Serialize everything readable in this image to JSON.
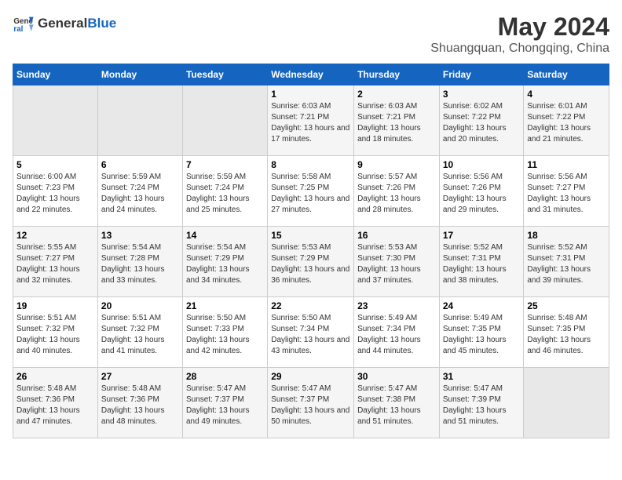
{
  "header": {
    "logo_general": "General",
    "logo_blue": "Blue",
    "title": "May 2024",
    "subtitle": "Shuangquan, Chongqing, China"
  },
  "days_of_week": [
    "Sunday",
    "Monday",
    "Tuesday",
    "Wednesday",
    "Thursday",
    "Friday",
    "Saturday"
  ],
  "weeks": [
    [
      {
        "day": "",
        "sunrise": "",
        "sunset": "",
        "daylight": "",
        "empty": true
      },
      {
        "day": "",
        "sunrise": "",
        "sunset": "",
        "daylight": "",
        "empty": true
      },
      {
        "day": "",
        "sunrise": "",
        "sunset": "",
        "daylight": "",
        "empty": true
      },
      {
        "day": "1",
        "sunrise": "Sunrise: 6:03 AM",
        "sunset": "Sunset: 7:21 PM",
        "daylight": "Daylight: 13 hours and 17 minutes.",
        "empty": false
      },
      {
        "day": "2",
        "sunrise": "Sunrise: 6:03 AM",
        "sunset": "Sunset: 7:21 PM",
        "daylight": "Daylight: 13 hours and 18 minutes.",
        "empty": false
      },
      {
        "day": "3",
        "sunrise": "Sunrise: 6:02 AM",
        "sunset": "Sunset: 7:22 PM",
        "daylight": "Daylight: 13 hours and 20 minutes.",
        "empty": false
      },
      {
        "day": "4",
        "sunrise": "Sunrise: 6:01 AM",
        "sunset": "Sunset: 7:22 PM",
        "daylight": "Daylight: 13 hours and 21 minutes.",
        "empty": false
      }
    ],
    [
      {
        "day": "5",
        "sunrise": "Sunrise: 6:00 AM",
        "sunset": "Sunset: 7:23 PM",
        "daylight": "Daylight: 13 hours and 22 minutes.",
        "empty": false
      },
      {
        "day": "6",
        "sunrise": "Sunrise: 5:59 AM",
        "sunset": "Sunset: 7:24 PM",
        "daylight": "Daylight: 13 hours and 24 minutes.",
        "empty": false
      },
      {
        "day": "7",
        "sunrise": "Sunrise: 5:59 AM",
        "sunset": "Sunset: 7:24 PM",
        "daylight": "Daylight: 13 hours and 25 minutes.",
        "empty": false
      },
      {
        "day": "8",
        "sunrise": "Sunrise: 5:58 AM",
        "sunset": "Sunset: 7:25 PM",
        "daylight": "Daylight: 13 hours and 27 minutes.",
        "empty": false
      },
      {
        "day": "9",
        "sunrise": "Sunrise: 5:57 AM",
        "sunset": "Sunset: 7:26 PM",
        "daylight": "Daylight: 13 hours and 28 minutes.",
        "empty": false
      },
      {
        "day": "10",
        "sunrise": "Sunrise: 5:56 AM",
        "sunset": "Sunset: 7:26 PM",
        "daylight": "Daylight: 13 hours and 29 minutes.",
        "empty": false
      },
      {
        "day": "11",
        "sunrise": "Sunrise: 5:56 AM",
        "sunset": "Sunset: 7:27 PM",
        "daylight": "Daylight: 13 hours and 31 minutes.",
        "empty": false
      }
    ],
    [
      {
        "day": "12",
        "sunrise": "Sunrise: 5:55 AM",
        "sunset": "Sunset: 7:27 PM",
        "daylight": "Daylight: 13 hours and 32 minutes.",
        "empty": false
      },
      {
        "day": "13",
        "sunrise": "Sunrise: 5:54 AM",
        "sunset": "Sunset: 7:28 PM",
        "daylight": "Daylight: 13 hours and 33 minutes.",
        "empty": false
      },
      {
        "day": "14",
        "sunrise": "Sunrise: 5:54 AM",
        "sunset": "Sunset: 7:29 PM",
        "daylight": "Daylight: 13 hours and 34 minutes.",
        "empty": false
      },
      {
        "day": "15",
        "sunrise": "Sunrise: 5:53 AM",
        "sunset": "Sunset: 7:29 PM",
        "daylight": "Daylight: 13 hours and 36 minutes.",
        "empty": false
      },
      {
        "day": "16",
        "sunrise": "Sunrise: 5:53 AM",
        "sunset": "Sunset: 7:30 PM",
        "daylight": "Daylight: 13 hours and 37 minutes.",
        "empty": false
      },
      {
        "day": "17",
        "sunrise": "Sunrise: 5:52 AM",
        "sunset": "Sunset: 7:31 PM",
        "daylight": "Daylight: 13 hours and 38 minutes.",
        "empty": false
      },
      {
        "day": "18",
        "sunrise": "Sunrise: 5:52 AM",
        "sunset": "Sunset: 7:31 PM",
        "daylight": "Daylight: 13 hours and 39 minutes.",
        "empty": false
      }
    ],
    [
      {
        "day": "19",
        "sunrise": "Sunrise: 5:51 AM",
        "sunset": "Sunset: 7:32 PM",
        "daylight": "Daylight: 13 hours and 40 minutes.",
        "empty": false
      },
      {
        "day": "20",
        "sunrise": "Sunrise: 5:51 AM",
        "sunset": "Sunset: 7:32 PM",
        "daylight": "Daylight: 13 hours and 41 minutes.",
        "empty": false
      },
      {
        "day": "21",
        "sunrise": "Sunrise: 5:50 AM",
        "sunset": "Sunset: 7:33 PM",
        "daylight": "Daylight: 13 hours and 42 minutes.",
        "empty": false
      },
      {
        "day": "22",
        "sunrise": "Sunrise: 5:50 AM",
        "sunset": "Sunset: 7:34 PM",
        "daylight": "Daylight: 13 hours and 43 minutes.",
        "empty": false
      },
      {
        "day": "23",
        "sunrise": "Sunrise: 5:49 AM",
        "sunset": "Sunset: 7:34 PM",
        "daylight": "Daylight: 13 hours and 44 minutes.",
        "empty": false
      },
      {
        "day": "24",
        "sunrise": "Sunrise: 5:49 AM",
        "sunset": "Sunset: 7:35 PM",
        "daylight": "Daylight: 13 hours and 45 minutes.",
        "empty": false
      },
      {
        "day": "25",
        "sunrise": "Sunrise: 5:48 AM",
        "sunset": "Sunset: 7:35 PM",
        "daylight": "Daylight: 13 hours and 46 minutes.",
        "empty": false
      }
    ],
    [
      {
        "day": "26",
        "sunrise": "Sunrise: 5:48 AM",
        "sunset": "Sunset: 7:36 PM",
        "daylight": "Daylight: 13 hours and 47 minutes.",
        "empty": false
      },
      {
        "day": "27",
        "sunrise": "Sunrise: 5:48 AM",
        "sunset": "Sunset: 7:36 PM",
        "daylight": "Daylight: 13 hours and 48 minutes.",
        "empty": false
      },
      {
        "day": "28",
        "sunrise": "Sunrise: 5:47 AM",
        "sunset": "Sunset: 7:37 PM",
        "daylight": "Daylight: 13 hours and 49 minutes.",
        "empty": false
      },
      {
        "day": "29",
        "sunrise": "Sunrise: 5:47 AM",
        "sunset": "Sunset: 7:37 PM",
        "daylight": "Daylight: 13 hours and 50 minutes.",
        "empty": false
      },
      {
        "day": "30",
        "sunrise": "Sunrise: 5:47 AM",
        "sunset": "Sunset: 7:38 PM",
        "daylight": "Daylight: 13 hours and 51 minutes.",
        "empty": false
      },
      {
        "day": "31",
        "sunrise": "Sunrise: 5:47 AM",
        "sunset": "Sunset: 7:39 PM",
        "daylight": "Daylight: 13 hours and 51 minutes.",
        "empty": false
      },
      {
        "day": "",
        "sunrise": "",
        "sunset": "",
        "daylight": "",
        "empty": true
      }
    ]
  ]
}
